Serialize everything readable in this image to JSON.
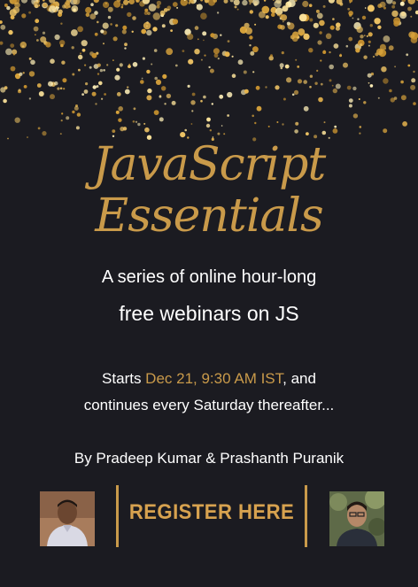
{
  "title": {
    "line1": "JavaScript",
    "line2": "Essentials"
  },
  "subtitle": {
    "line1": "A series of online hour-long",
    "line2": "free webinars on JS"
  },
  "schedule": {
    "prefix": "Starts ",
    "highlight": "Dec 21, 9:30 AM IST",
    "suffix": ", and",
    "line2": "continues every Saturday thereafter..."
  },
  "byline": "By Pradeep Kumar & Prashanth Puranik",
  "register_label": "REGISTER HERE",
  "colors": {
    "background": "#1b1b21",
    "accent_gold": "#c99a4a",
    "text": "#ffffff"
  }
}
